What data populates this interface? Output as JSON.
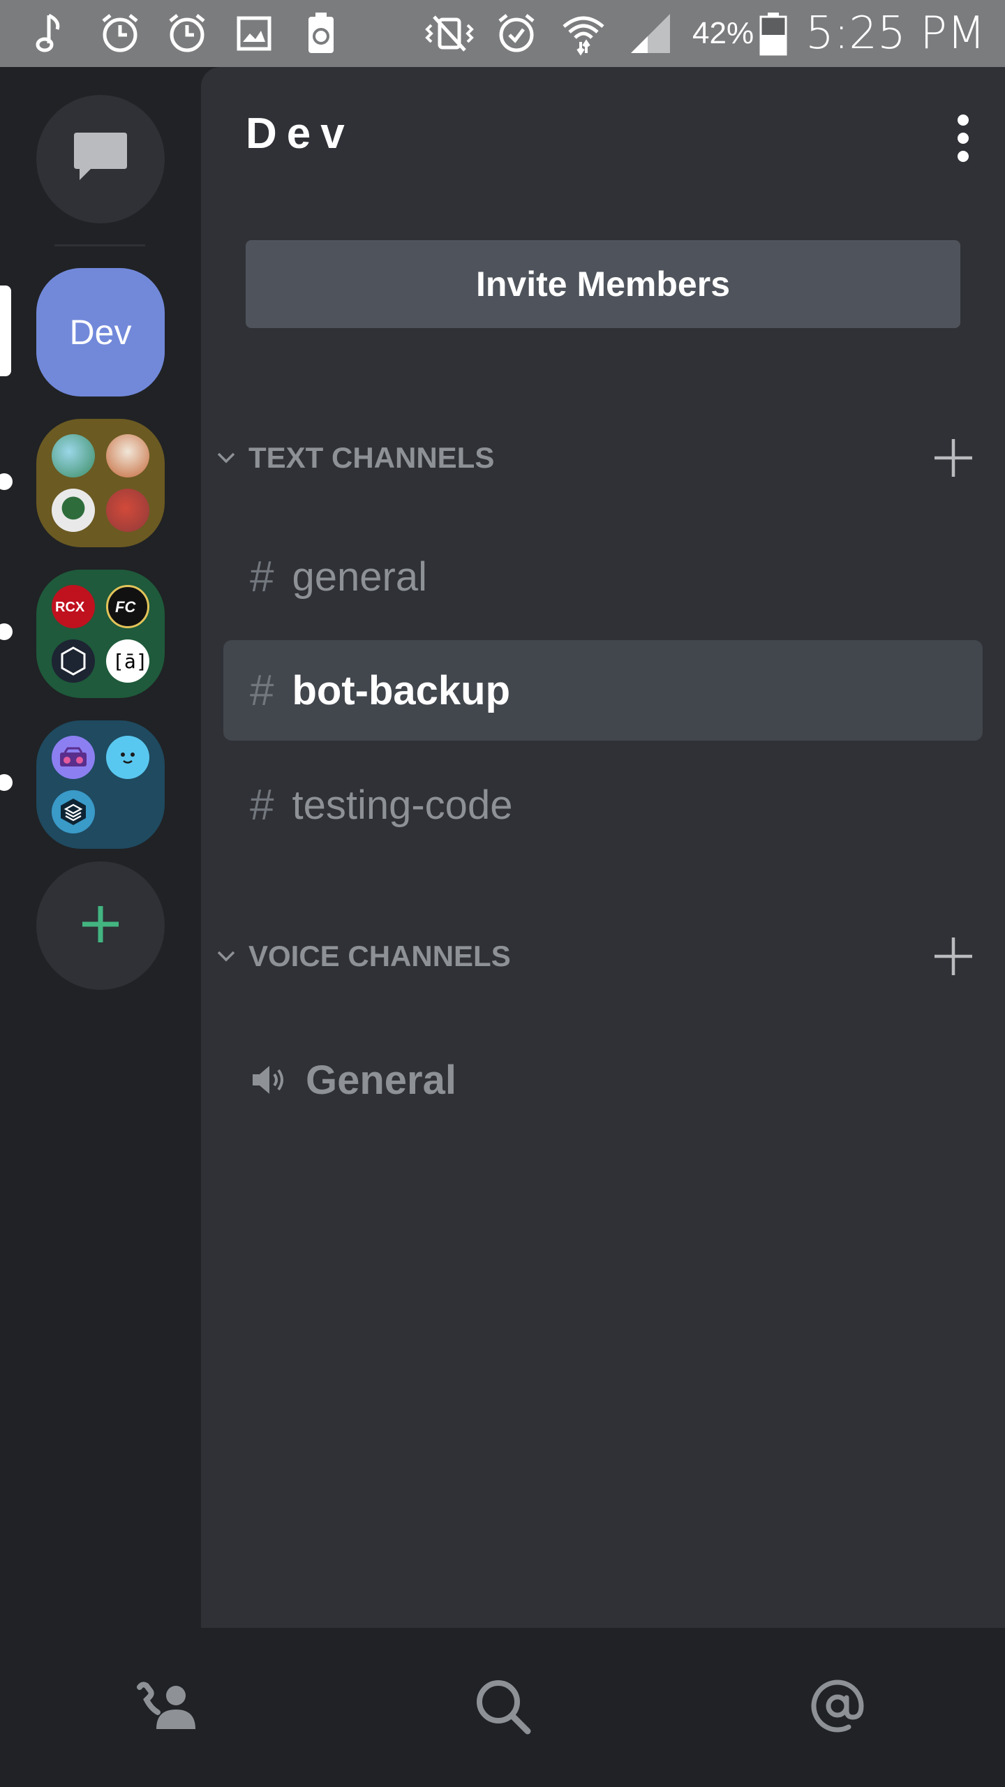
{
  "status_bar": {
    "battery_percent": "42%",
    "time": "5:25 PM",
    "left_icons": [
      "music-note-icon",
      "alarm-icon",
      "alarm-icon",
      "image-icon",
      "battery-saver-icon"
    ],
    "right_icons": [
      "vibrate-mute-icon",
      "alarm-check-icon",
      "wifi-icon",
      "cell-signal-icon",
      "battery-icon"
    ]
  },
  "rail": {
    "dev_label": "Dev",
    "colors": {
      "accent": "#7289da",
      "add_green": "#43b581"
    }
  },
  "server": {
    "name": "Dev",
    "invite_label": "Invite Members"
  },
  "categories": {
    "text": "TEXT CHANNELS",
    "voice": "VOICE CHANNELS"
  },
  "text_channels": [
    {
      "name": "general",
      "selected": false
    },
    {
      "name": "bot-backup",
      "selected": true
    },
    {
      "name": "testing-code",
      "selected": false
    }
  ],
  "voice_channels": [
    {
      "name": "General"
    }
  ],
  "bottom_nav": [
    "friends-icon",
    "search-icon",
    "mentions-icon"
  ]
}
